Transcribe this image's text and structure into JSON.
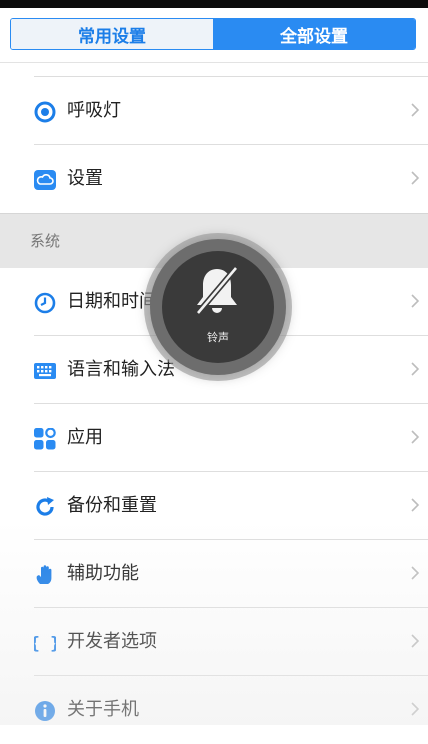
{
  "tabs": {
    "common": "常用设置",
    "all": "全部设置"
  },
  "rows_top": [
    {
      "label": "呼吸灯",
      "icon": "breathing-light-icon"
    },
    {
      "label": "设置",
      "icon": "cloud-settings-icon"
    }
  ],
  "section": {
    "title": "系统"
  },
  "rows_system": [
    {
      "label": "日期和时间",
      "icon": "clock-icon"
    },
    {
      "label": "语言和输入法",
      "icon": "keyboard-icon"
    },
    {
      "label": "应用",
      "icon": "apps-icon"
    },
    {
      "label": "备份和重置",
      "icon": "refresh-icon"
    },
    {
      "label": "辅助功能",
      "icon": "hand-icon"
    },
    {
      "label": "开发者选项",
      "icon": "braces-icon"
    },
    {
      "label": "关于手机",
      "icon": "info-icon"
    }
  ],
  "toast": {
    "label": "铃声",
    "icon": "bell-muted-icon"
  },
  "colors": {
    "accent": "#2a8bf2",
    "section_bg": "#e6e6e6"
  }
}
